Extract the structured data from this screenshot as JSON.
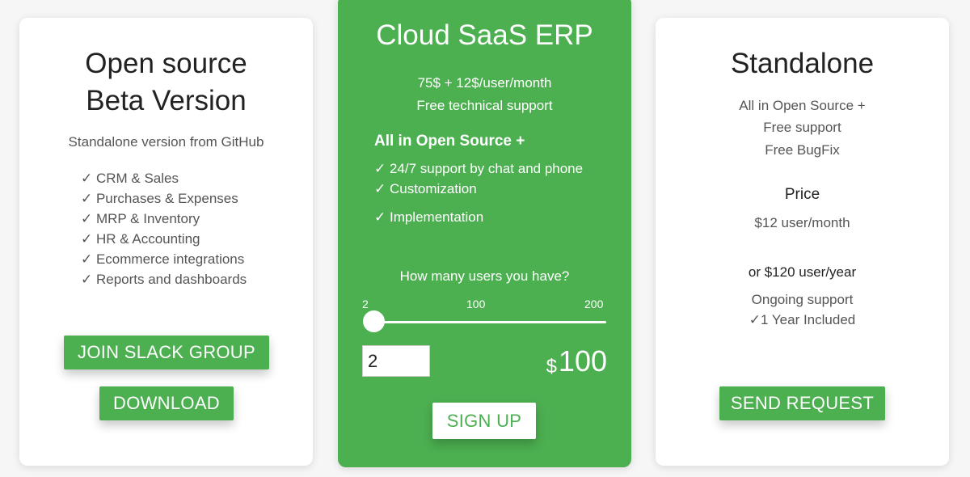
{
  "open_source": {
    "title_line1": "Open source",
    "title_line2": "Beta Version",
    "subtitle": "Standalone version from GitHub",
    "features": [
      "✓ CRM & Sales",
      "✓ Purchases & Expenses",
      "✓ MRP & Inventory",
      "✓ HR & Accounting",
      "✓ Ecommerce integrations",
      "✓ Reports and dashboards"
    ],
    "join_button": "JOIN SLACK GROUP",
    "download_button": "DOWNLOAD"
  },
  "cloud": {
    "title": "Cloud SaaS ERP",
    "price_line": "75$ + 12$/user/month",
    "support_line": "Free technical support",
    "heading": "All in Open Source +",
    "features": [
      "✓ 24/7 support by chat and phone",
      "✓ Customization",
      "✓ Implementation"
    ],
    "question": "How many users you have?",
    "slider": {
      "min": "2",
      "mid": "100",
      "max": "200",
      "value": 2
    },
    "users_value": "2",
    "currency": "$",
    "total": "100",
    "signup_button": "SIGN UP"
  },
  "standalone": {
    "title": "Standalone",
    "line1": "All in Open Source +",
    "line2": "Free support",
    "line3": "Free BugFix",
    "price_label": "Price",
    "price_month": "$12 user/month",
    "price_year": "or $120 user/year",
    "ongoing": "Ongoing support",
    "included": "✓1 Year Included",
    "request_button": "SEND REQUEST"
  },
  "colors": {
    "accent": "#4caf50",
    "background": "#f6f6f6"
  }
}
